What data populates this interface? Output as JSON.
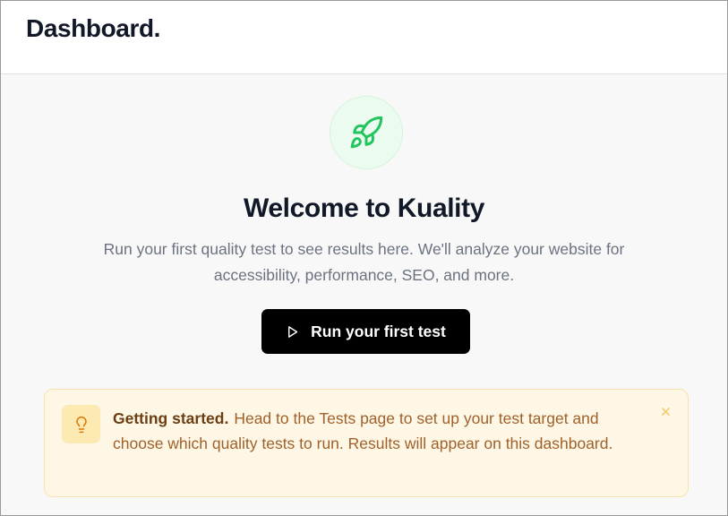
{
  "header": {
    "title": "Dashboard."
  },
  "hero": {
    "icon": "rocket-icon",
    "title": "Welcome to Kuality",
    "description_line1": "Run your first quality test to see results here. We'll analyze your website for",
    "description_line2": "accessibility, performance, SEO, and more.",
    "button_icon": "play-icon",
    "button_label": "Run your first test"
  },
  "callout": {
    "icon": "lightbulb-icon",
    "title": "Getting started.",
    "body": "Head to the Tests page to set up your test target and choose which quality tests to run. Results will appear on this dashboard.",
    "close_icon": "close-icon"
  },
  "colors": {
    "accent_green": "#22c55e",
    "button_bg": "#000000",
    "callout_bg": "#fef7e6",
    "callout_text": "#a0612a",
    "callout_title": "#6b3f13"
  }
}
